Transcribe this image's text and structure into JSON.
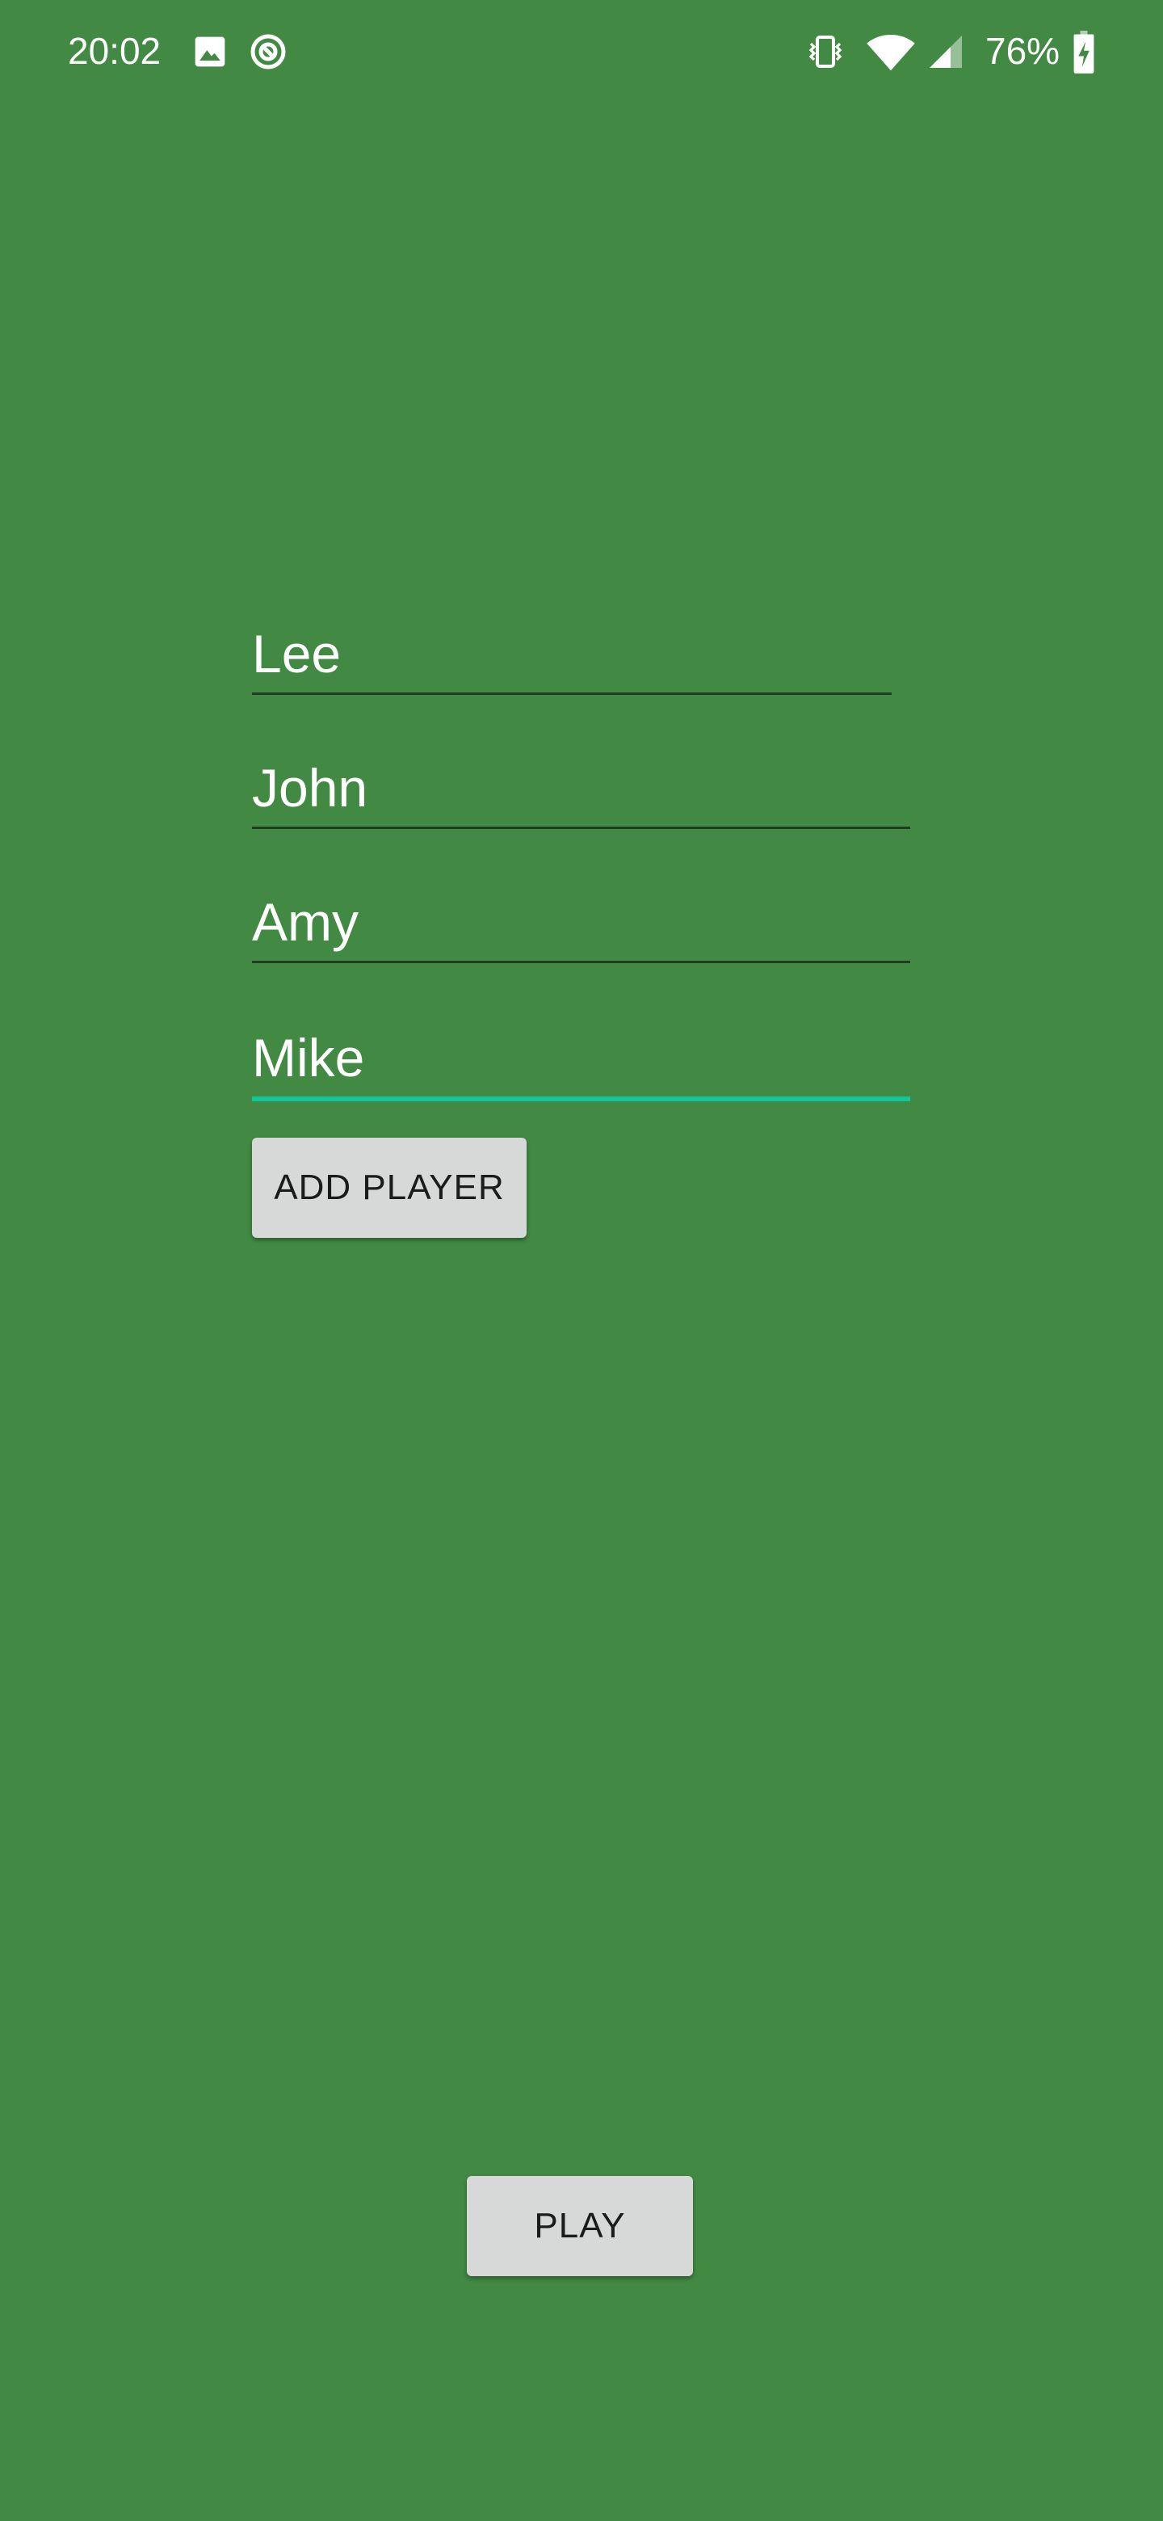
{
  "status_bar": {
    "time": "20:02",
    "battery_percent": "76%",
    "icons": [
      "image-icon",
      "focus-mode-icon",
      "vibrate-icon",
      "wifi-icon",
      "cell-signal-icon",
      "battery-charging-icon"
    ]
  },
  "players": {
    "fields": [
      {
        "value": "Lee"
      },
      {
        "value": "John"
      },
      {
        "value": "Amy"
      },
      {
        "value": "Mike"
      }
    ]
  },
  "buttons": {
    "add_player_label": "ADD PLAYER",
    "play_label": "PLAY"
  },
  "colors": {
    "background": "#428a44",
    "active_underline": "#12c79f",
    "button_bg": "#d7d8d8"
  }
}
